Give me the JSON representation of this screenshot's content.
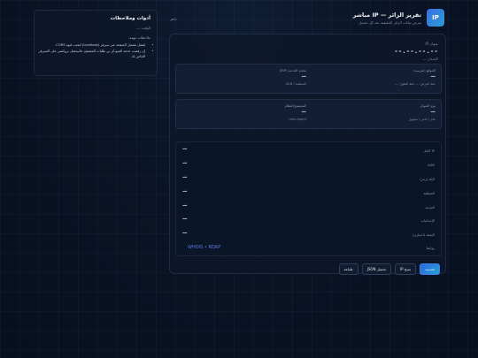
{
  "header": {
    "logo_text": "IP",
    "title": "تقرير الزائر — IP مباشر",
    "subtitle": "يعرض بيانات الزائر الحقيقية عند كل تحميل",
    "status": "جاهز"
  },
  "ip": {
    "label": "عنوان IP",
    "value": "--.--.--.--",
    "version_label": "الإصدار: —"
  },
  "location": {
    "label": "الموقع (تقريبية)",
    "value": "—",
    "sub": "خط العرض: — خط الطول: —"
  },
  "isp": {
    "label": "مقدم الخدمة (ISP)",
    "value": "—",
    "sub": "المنظمة / ASN"
  },
  "addr_type": {
    "label": "نوع العنوان",
    "value": "—",
    "sub": "عام / خاص / مجهول"
  },
  "browser": {
    "label": "المتصفح/النظام",
    "value": "—",
    "sub": "User-Agent"
  },
  "details": [
    {
      "key": "IP كامل",
      "value": "—"
    },
    {
      "key": "ASN",
      "value": "—"
    },
    {
      "key": "البلد (رمز)",
      "value": "—"
    },
    {
      "key": "المنطقة",
      "value": "—"
    },
    {
      "key": "المدينة",
      "value": "—"
    },
    {
      "key": "الإحداثيات",
      "value": "—"
    },
    {
      "key": "المنفذ (اختياري)",
      "value": "—"
    }
  ],
  "links": {
    "key": "روابط",
    "whois": "WHOIS",
    "separator": "•",
    "rdap": "RDAP"
  },
  "actions": {
    "refresh": "تحديث",
    "copy_ip": "نسخ IP",
    "download_json": "تحميل JSON",
    "print": "طباعة"
  },
  "notes": {
    "title": "أدوات وملاحظات",
    "time": "الوقت: —",
    "subtitle": "ملاحظات مهمة:",
    "items": [
      "يُفضل تشغيل الصفحة عبر سيرفر (localhost) لتجنب قيود CORS.",
      "إن رفضت خدمة الجيو-آي بي طلبات المتصفح، فاستعمل بروكسي على السيرفر الخاص بك."
    ]
  },
  "colors": {
    "accent": "#2c67e0",
    "link": "#5b7be8",
    "background": "#0a1426"
  }
}
